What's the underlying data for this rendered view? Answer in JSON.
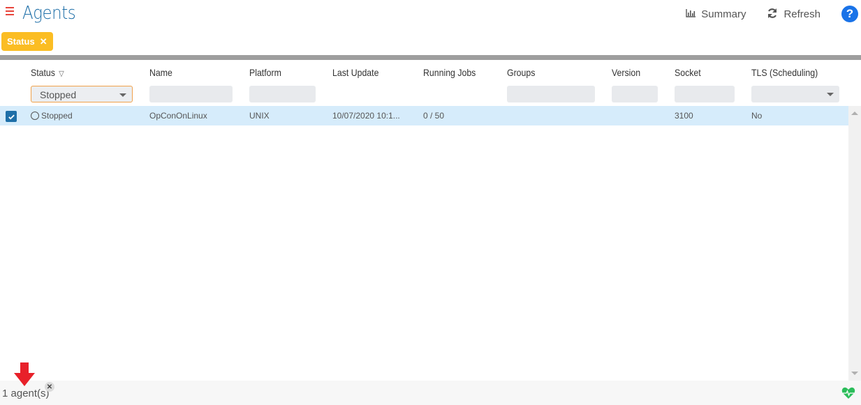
{
  "header": {
    "title": "Agents",
    "menu_icon": "hamburger-icon",
    "actions": {
      "summary_label": "Summary",
      "summary_icon": "bar-chart-icon",
      "refresh_label": "Refresh",
      "refresh_icon": "refresh-icon",
      "help_label": "?",
      "help_icon": "help-icon"
    }
  },
  "filter_chips": [
    {
      "label": "Status",
      "remove_symbol": "✕"
    }
  ],
  "colors": {
    "accent": "#1e6fa8",
    "chip": "#fbbd23",
    "menu": "#e8453c",
    "selected_row": "#d6ecfb",
    "health": "#2bbd5a",
    "arrow": "#e8212a"
  },
  "grid": {
    "columns": [
      {
        "label": "Status",
        "filter_type": "select",
        "filter_value": "Stopped",
        "has_filter_icon": true
      },
      {
        "label": "Name",
        "filter_type": "text",
        "filter_value": ""
      },
      {
        "label": "Platform",
        "filter_type": "text",
        "filter_value": ""
      },
      {
        "label": "Last Update",
        "filter_type": "none"
      },
      {
        "label": "Running Jobs",
        "filter_type": "none"
      },
      {
        "label": "Groups",
        "filter_type": "text",
        "filter_value": ""
      },
      {
        "label": "Version",
        "filter_type": "text",
        "filter_value": ""
      },
      {
        "label": "Socket",
        "filter_type": "text",
        "filter_value": ""
      },
      {
        "label": "TLS (Scheduling)",
        "filter_type": "select",
        "filter_value": ""
      }
    ],
    "rows": [
      {
        "selected": true,
        "status": "Stopped",
        "name": "OpConOnLinux",
        "platform": "UNIX",
        "last_update": "10/07/2020 10:1...",
        "running_jobs": "0 / 50",
        "groups": "",
        "version": "",
        "socket": "3100",
        "tls": "No"
      }
    ]
  },
  "footer": {
    "count_text": "1 agent(s)",
    "clear_symbol": "✕",
    "health_icon": "heartbeat-icon"
  }
}
